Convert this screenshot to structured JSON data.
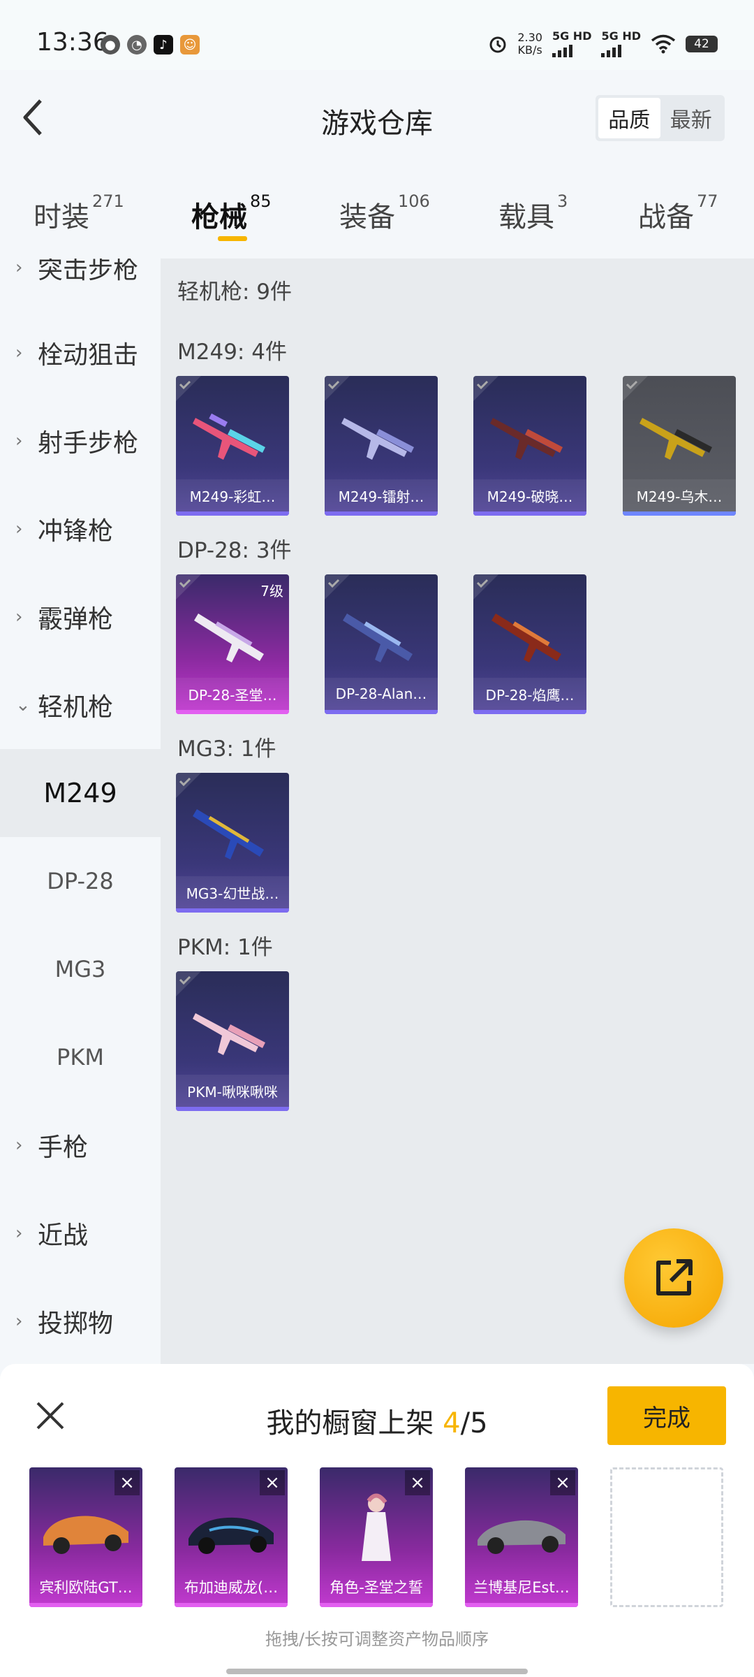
{
  "status_bar": {
    "time": "13:36",
    "speed_value": "2.30",
    "speed_unit": "KB/s",
    "net1": "5G HD",
    "net2": "5G HD",
    "battery": "42"
  },
  "header": {
    "title": "游戏仓库",
    "sort_options": [
      "品质",
      "最新"
    ],
    "active_sort": "品质"
  },
  "tabs": [
    {
      "label": "时装",
      "count": "271"
    },
    {
      "label": "枪械",
      "count": "85"
    },
    {
      "label": "装备",
      "count": "106"
    },
    {
      "label": "载具",
      "count": "3"
    },
    {
      "label": "战备",
      "count": "77"
    }
  ],
  "sidebar": {
    "categories": {
      "assault": "突击步枪",
      "bolt": "栓动狙击",
      "marksman": "射手步枪",
      "smg": "冲锋枪",
      "shotgun": "霰弹枪",
      "lmg": "轻机枪",
      "pistol": "手枪",
      "melee": "近战",
      "throwable": "投掷物"
    },
    "lmg_subitems": [
      "M249",
      "DP-28",
      "MG3",
      "PKM"
    ]
  },
  "content": {
    "category_title": "轻机枪: 9件",
    "sections": {
      "m249": {
        "title": "M249: 4件",
        "items": [
          "M249-彩虹…",
          "M249-镭射…",
          "M249-破晓…",
          "M249-乌木…"
        ]
      },
      "dp28": {
        "title": "DP-28: 3件",
        "items": [
          "DP-28-圣堂…",
          "DP-28-Alan…",
          "DP-28-焰鹰…"
        ],
        "level_badge": "7级"
      },
      "mg3": {
        "title": "MG3: 1件",
        "items": [
          "MG3-幻世战…"
        ]
      },
      "pkm": {
        "title": "PKM: 1件",
        "items": [
          "PKM-啾咪啾咪"
        ]
      }
    }
  },
  "panel": {
    "title_prefix": "我的橱窗上架",
    "count": "4",
    "total": "/5",
    "done_label": "完成",
    "slots": [
      "宾利欧陆GT…",
      "布加迪威龙(…",
      "角色-圣堂之誓",
      "兰博基尼Est…"
    ],
    "hint": "拖拽/长按可调整资产物品顺序"
  },
  "colors": {
    "accent": "#f7b500",
    "purple_card": "#3a3779",
    "pink_card": "#c23ad0"
  }
}
